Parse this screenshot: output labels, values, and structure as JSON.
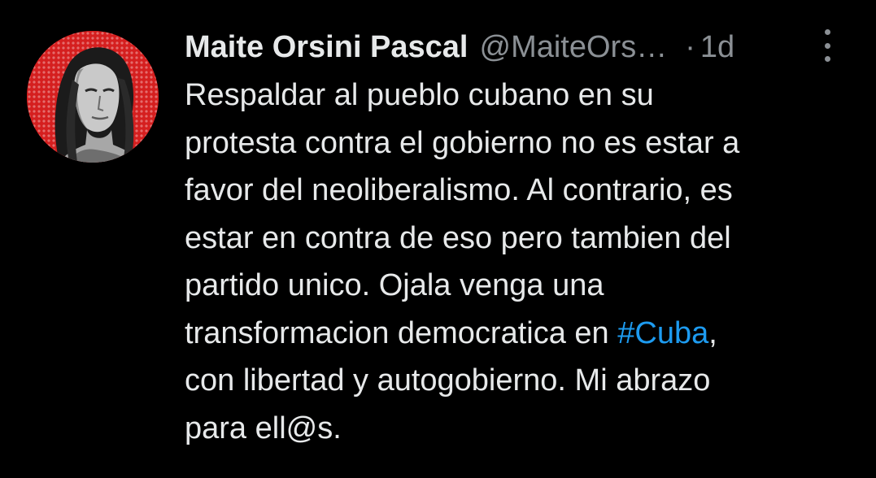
{
  "tweet": {
    "author": {
      "display_name": "Maite Orsini Pascal",
      "handle": "@MaiteOrs…",
      "avatar_icon": "profile-photo-avatar"
    },
    "separator": "·",
    "time": "1d",
    "more_icon": "vertical-ellipsis-icon",
    "text_lines": [
      "Respaldar al pueblo cubano en su",
      "protesta contra el gobierno no es estar a",
      "favor del neoliberalismo. Al contrario, es",
      "estar en contra de eso pero tambien del",
      "partido unico. Ojala venga una"
    ],
    "line6_before": "transformacion democratica en ",
    "hashtag": "#Cuba",
    "line6_after": ",",
    "text_lines_end": [
      "con libertad y autogobierno. Mi abrazo",
      "para ell@s."
    ]
  },
  "colors": {
    "background": "#000000",
    "text": "#e7e9ea",
    "secondary": "#8b9095",
    "link": "#1d9bf0",
    "avatar_bg": "#d51f1f"
  }
}
